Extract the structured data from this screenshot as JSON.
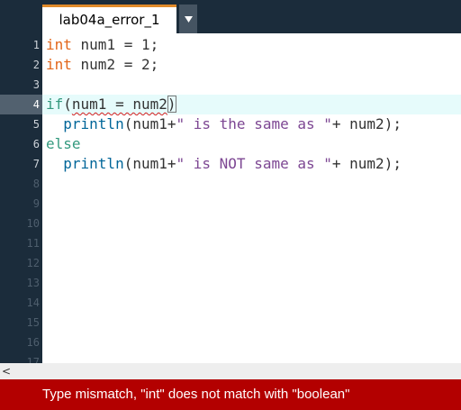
{
  "tab": {
    "title": "lab04a_error_1"
  },
  "editor": {
    "current_line": 4,
    "line_numbers": [
      "1",
      "2",
      "3",
      "4",
      "5",
      "6",
      "7",
      "8",
      "9",
      "10",
      "11",
      "12",
      "13",
      "14",
      "15",
      "16",
      "17"
    ],
    "lines": [
      [
        {
          "t": "int",
          "c": "kw-type"
        },
        {
          "t": " num1 = 1;"
        }
      ],
      [
        {
          "t": "int",
          "c": "kw-type"
        },
        {
          "t": " num2 = 2;"
        }
      ],
      [],
      [
        {
          "t": "if",
          "c": "kw-ctrl"
        },
        {
          "t": "("
        },
        {
          "t": "num1 = num2",
          "c": "err"
        },
        {
          "t": ")",
          "c": "bracket-box"
        }
      ],
      [
        {
          "t": "  "
        },
        {
          "t": "println",
          "c": "kw-fn"
        },
        {
          "t": "(num1+"
        },
        {
          "t": "\" is the same as \"",
          "c": "str"
        },
        {
          "t": "+ num2);"
        }
      ],
      [
        {
          "t": "else",
          "c": "kw-ctrl"
        }
      ],
      [
        {
          "t": "  "
        },
        {
          "t": "println",
          "c": "kw-fn"
        },
        {
          "t": "(num1+"
        },
        {
          "t": "\" is NOT same as \"",
          "c": "str"
        },
        {
          "t": "+ num2);"
        }
      ]
    ]
  },
  "scrollbar": {
    "arrow": "<"
  },
  "console": {
    "error_message": "Type mismatch, \"int\" does not match with \"boolean\""
  },
  "colors": {
    "accent": "#e08a2a",
    "error_bg": "#b30000",
    "keyword_type": "#e2661a",
    "keyword_control": "#33997e",
    "function": "#006699",
    "string": "#7d4793"
  },
  "icons": {
    "tab_menu": "chevron-down-icon"
  }
}
